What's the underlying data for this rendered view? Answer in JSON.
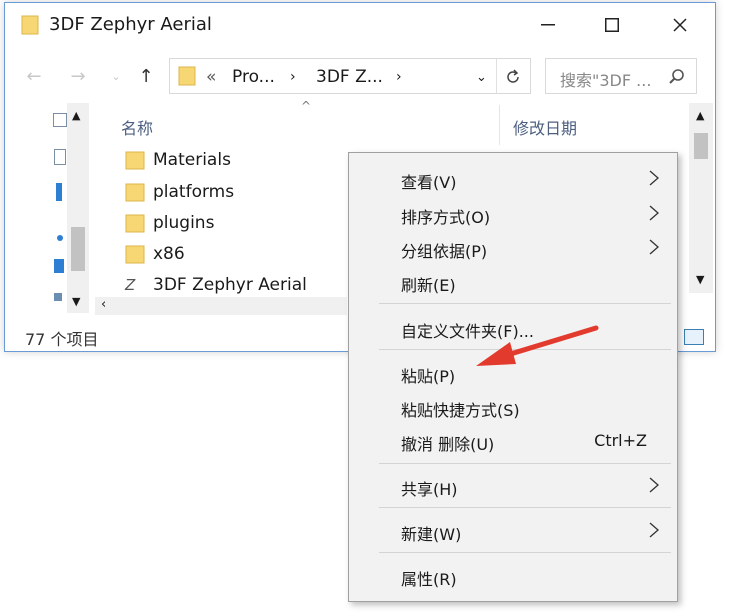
{
  "window": {
    "title": "3DF Zephyr Aerial",
    "controls": {
      "minimize": "—",
      "maximize": "☐",
      "close": "✕"
    }
  },
  "address": {
    "chevrons": "«",
    "crumbs": [
      "Pro...",
      "3DF Z..."
    ],
    "refresh_icon": "refresh-icon"
  },
  "search": {
    "placeholder": "搜索\"3DF ..."
  },
  "columns": {
    "name": "名称",
    "modified": "修改日期"
  },
  "files": [
    {
      "name": "Materials",
      "type": "folder"
    },
    {
      "name": "platforms",
      "type": "folder"
    },
    {
      "name": "plugins",
      "type": "folder"
    },
    {
      "name": "x86",
      "type": "folder"
    },
    {
      "name": "3DF Zephyr Aerial",
      "type": "app"
    }
  ],
  "status": {
    "count": "77 个项目"
  },
  "context_menu": {
    "items": [
      {
        "label": "查看(V)",
        "submenu": true
      },
      {
        "label": "排序方式(O)",
        "submenu": true
      },
      {
        "label": "分组依据(P)",
        "submenu": true
      },
      {
        "label": "刷新(E)",
        "submenu": false
      },
      {
        "label": "自定义文件夹(F)...",
        "submenu": false
      },
      {
        "label": "粘贴(P)",
        "submenu": false
      },
      {
        "label": "粘贴快捷方式(S)",
        "submenu": false
      },
      {
        "label": "撤消 删除(U)",
        "shortcut": "Ctrl+Z",
        "submenu": false
      },
      {
        "label": "共享(H)",
        "submenu": true
      },
      {
        "label": "新建(W)",
        "submenu": true
      },
      {
        "label": "属性(R)",
        "submenu": false
      }
    ]
  },
  "colors": {
    "accent": "#1e6fd9",
    "folder": "#f7d774",
    "annotation_arrow": "#e23b2e"
  }
}
